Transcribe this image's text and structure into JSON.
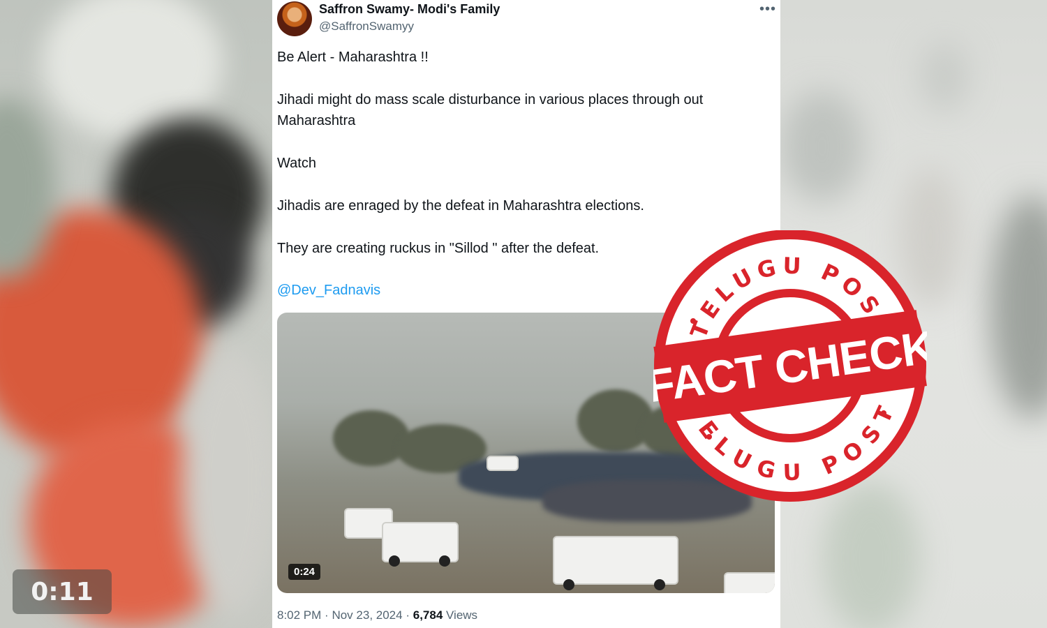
{
  "background": {
    "left_video_timer": "0:11"
  },
  "tweet": {
    "author": {
      "display_name": "Saffron Swamy- Modi's Family",
      "handle": "@SaffronSwamyy"
    },
    "more_icon": "ellipsis-icon",
    "lines": [
      "Be Alert - Maharashtra !!",
      "Jihadi might do mass scale disturbance in various places through out",
      "Maharashtra",
      "Watch",
      "Jihadis are enraged by the defeat in Maharashtra elections.",
      "They are creating ruckus in \"Sillod \" after the defeat."
    ],
    "mention": "@Dev_Fadnavis",
    "video": {
      "duration": "0:24"
    },
    "meta": {
      "time": "8:02 PM",
      "separator": "·",
      "date": "Nov 23, 2024",
      "views_count": "6,784",
      "views_label": "Views"
    }
  },
  "stamp": {
    "top_text": "TELUGU POST",
    "center_text": "FACT CHECK",
    "bottom_text": "TELUGU POST",
    "color": "#d9242b"
  }
}
